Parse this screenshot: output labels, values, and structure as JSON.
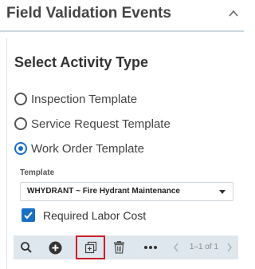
{
  "header": {
    "title": "Field Validation Events",
    "collapse_icon": "chevron-up-icon"
  },
  "section": {
    "title": "Select Activity Type"
  },
  "activity_types": [
    {
      "label": "Inspection Template",
      "selected": false
    },
    {
      "label": "Service Request Template",
      "selected": false
    },
    {
      "label": "Work Order Template",
      "selected": true
    }
  ],
  "template": {
    "label": "Template",
    "selected_value": "WHYDRANT ~ Fire Hydrant Maintenance"
  },
  "required_labor_cost": {
    "label": "Required Labor Cost",
    "checked": true
  },
  "toolbar": {
    "icons": [
      "search-icon",
      "add-icon",
      "copy-icon",
      "delete-icon",
      "more-icon"
    ],
    "pager": "1–1 of 1",
    "prev_icon": "chevron-left-icon",
    "next_icon": "chevron-right-icon"
  },
  "colors": {
    "accent": "#1a6fc4",
    "toolbar_bg": "#dfe7ee",
    "highlight": "#c81e28"
  }
}
